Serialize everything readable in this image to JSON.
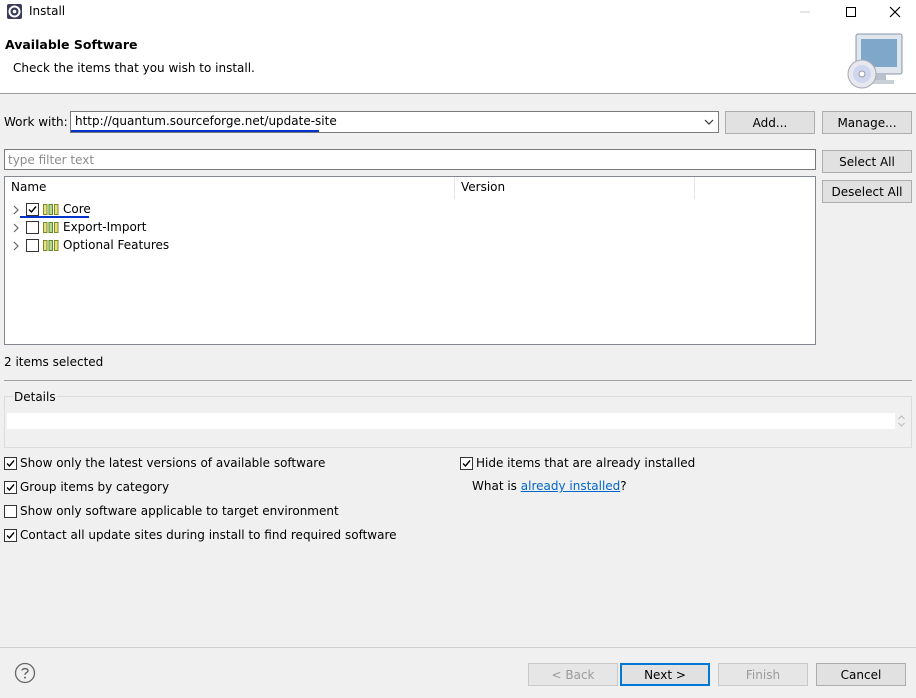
{
  "window": {
    "title": "Install"
  },
  "banner": {
    "title": "Available Software",
    "description": "Check the items that you wish to install."
  },
  "work_with": {
    "label": "Work with:",
    "value": "http://quantum.sourceforge.net/update-site",
    "add_label": "Add...",
    "manage_label": "Manage..."
  },
  "filter": {
    "placeholder": "type filter text"
  },
  "selection": {
    "select_all": "Select All",
    "deselect_all": "Deselect All"
  },
  "tree": {
    "columns": [
      "Name",
      "Version"
    ],
    "rows": [
      {
        "label": "Core",
        "checked": true
      },
      {
        "label": "Export-Import",
        "checked": false
      },
      {
        "label": "Optional Features",
        "checked": false
      }
    ]
  },
  "status": "2 items selected",
  "details": {
    "label": "Details"
  },
  "options": {
    "latest_only": {
      "label": "Show only the latest versions of available software",
      "checked": true
    },
    "group_by_category": {
      "label": "Group items by category",
      "checked": true
    },
    "target_env_only": {
      "label": "Show only software applicable to target environment",
      "checked": false
    },
    "contact_all_sites": {
      "label": "Contact all update sites during install to find required software",
      "checked": true
    },
    "hide_installed": {
      "label": "Hide items that are already installed",
      "checked": true
    },
    "what_is_prefix": "What is ",
    "installed_link": "already installed",
    "what_is_suffix": "?"
  },
  "footer": {
    "back": "< Back",
    "next": "Next >",
    "finish": "Finish",
    "cancel": "Cancel"
  },
  "icons": {
    "app": "eclipse-gear-icon",
    "help": "question-mark-icon",
    "feature": "feature-bars-icon",
    "banner": "monitor-cd-icon"
  },
  "colors": {
    "accent": "#0078d7",
    "link": "#0066cc",
    "underline": "#0033cc"
  }
}
